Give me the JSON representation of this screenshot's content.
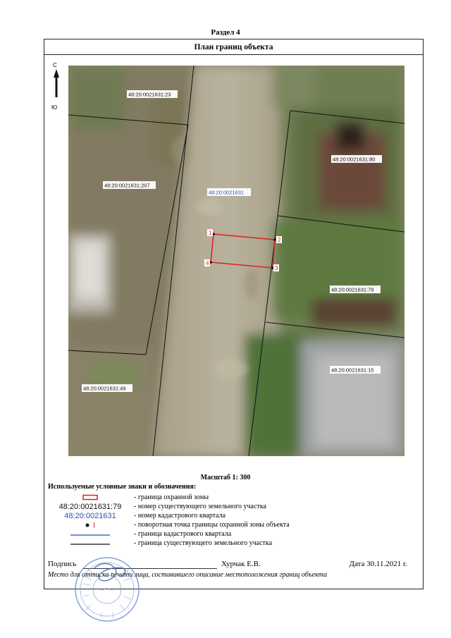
{
  "header": {
    "section": "Раздел 4",
    "title": "План границ объекта"
  },
  "compass": {
    "north": "С",
    "south": "Ю"
  },
  "map": {
    "parcel_labels": [
      "48:20:0021631:23",
      "48:20:0021631:207",
      "48:20:0021631:80",
      "48:20:0021631:79",
      "48:20:0021631:49",
      "48:20:0021631:15"
    ],
    "quarter_label": "48:20:0021631",
    "zone_points": [
      "1",
      "2",
      "3",
      "4"
    ],
    "colors": {
      "zone_boundary": "#e01f1f",
      "quarter_label": "#2d50b4",
      "parcel_boundary": "#111111",
      "quarter_boundary": "#1f4fb0"
    }
  },
  "scale": "Масштаб 1: 300",
  "legend": {
    "title": "Используемые условные знаки и обозначения:",
    "items": [
      {
        "symbol": "",
        "symbol_type": "red-rectangle",
        "desc": "- граница  охранной зоны"
      },
      {
        "symbol": "48:20:0021631:79",
        "symbol_type": "parcel-number",
        "desc": "- номер существующего земельного участка"
      },
      {
        "symbol": "48:20:0021631",
        "symbol_type": "quarter-number",
        "desc": "- номер кадастрового квартала"
      },
      {
        "symbol": "1",
        "symbol_type": "point",
        "desc": "- поворотная точка границы охранной зоны объекта"
      },
      {
        "symbol": "",
        "symbol_type": "blue-line",
        "desc": "- граница кадастрового квартала"
      },
      {
        "symbol": "",
        "symbol_type": "black-line",
        "desc": "- граница существующего земельного участка"
      }
    ]
  },
  "signature": {
    "label": "Подпись",
    "name": "Хурчак Е.В.",
    "date": "Дата 30.11.2021 г.",
    "place_note": "Место для оттиска печати лица, составившего описание местоположения границ объекта"
  }
}
